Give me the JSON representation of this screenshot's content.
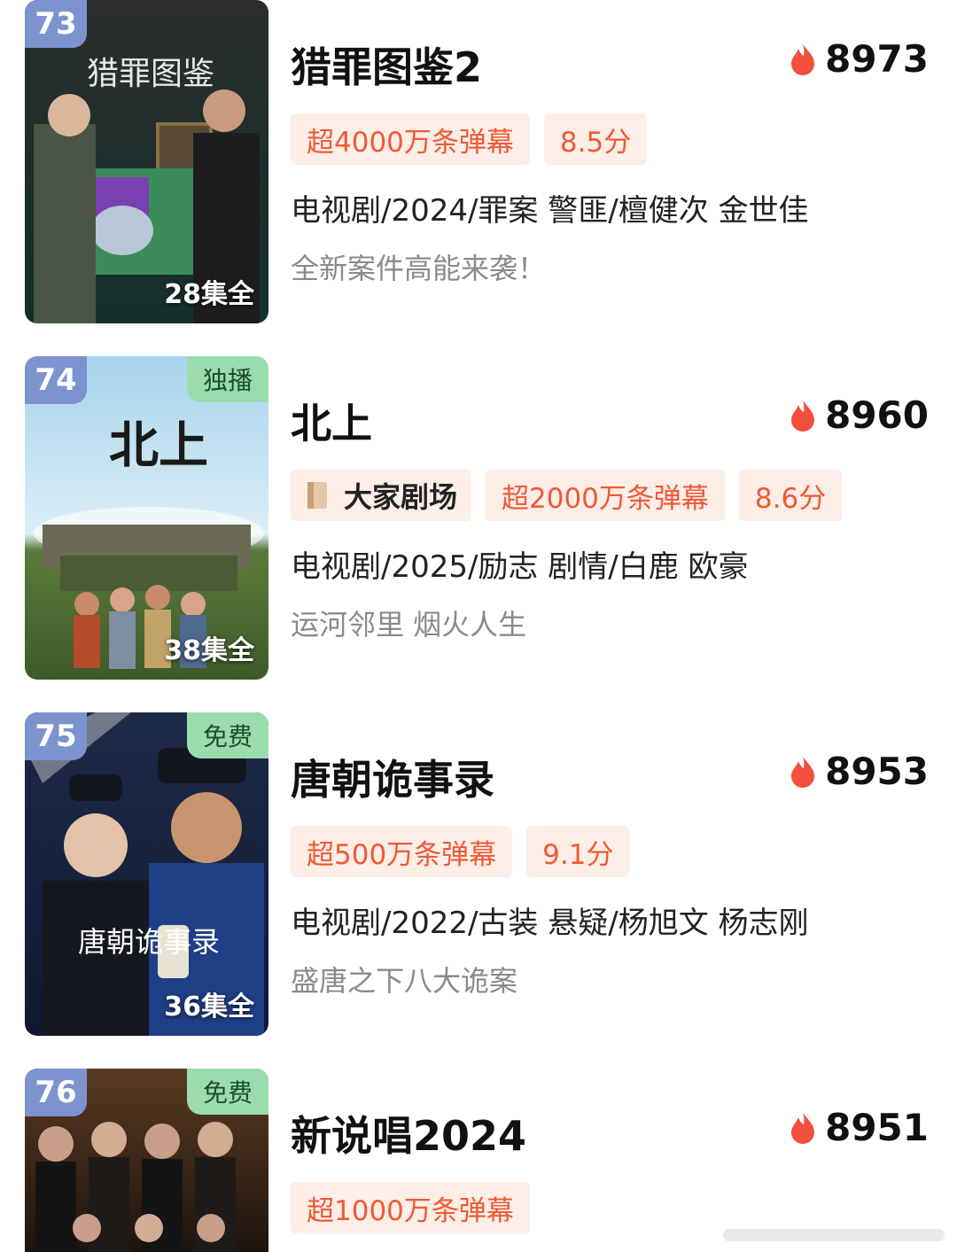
{
  "items": [
    {
      "rank": "73",
      "title": "猎罪图鉴2",
      "heat": "8973",
      "chips": [
        "超4000万条弹幕",
        "8.5分"
      ],
      "meta": "电视剧/2024/罪案 警匪/檀健次 金世佳",
      "desc": "全新案件高能来袭！",
      "episodes": "28集全"
    },
    {
      "rank": "74",
      "tag": "独播",
      "title": "北上",
      "heat": "8960",
      "theater": "大家剧场",
      "chips": [
        "超2000万条弹幕",
        "8.6分"
      ],
      "meta": "电视剧/2025/励志 剧情/白鹿 欧豪",
      "desc": "运河邻里 烟火人生",
      "episodes": "38集全"
    },
    {
      "rank": "75",
      "tag": "免费",
      "title": "唐朝诡事录",
      "heat": "8953",
      "chips": [
        "超500万条弹幕",
        "9.1分"
      ],
      "meta": "电视剧/2022/古装 悬疑/杨旭文 杨志刚",
      "desc": "盛唐之下八大诡案",
      "episodes": "36集全"
    },
    {
      "rank": "76",
      "tag": "免费",
      "title": "新说唱2024",
      "heat": "8951",
      "chips": [
        "超1000万条弹幕"
      ]
    }
  ],
  "colors": {
    "chip_bg": "#fdeee7",
    "chip_text": "#ef5a36",
    "rank_bg": "#7d93cf",
    "tag_bg": "#9bdcae",
    "flame": "#f2503c"
  },
  "icons": [
    "flame-icon",
    "book-icon"
  ]
}
